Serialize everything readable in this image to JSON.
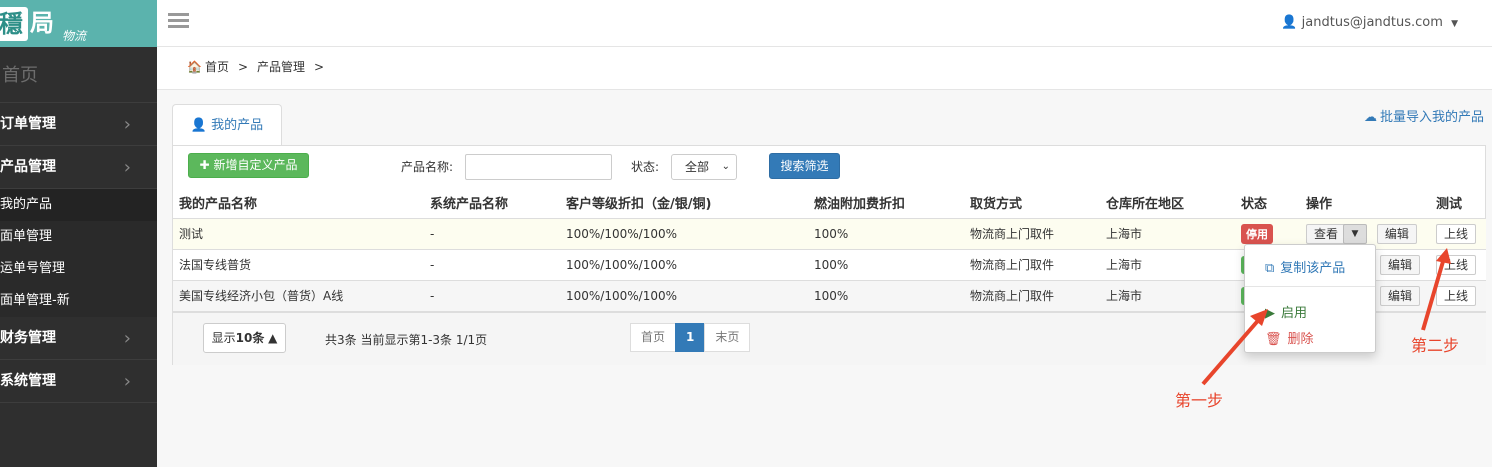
{
  "sidebar": {
    "logo_mark": "穩",
    "logo_mark2": "局",
    "logo_sub": "物流",
    "home": "首页",
    "items": [
      {
        "label": "订单管理"
      },
      {
        "label": "产品管理"
      },
      {
        "label": "财务管理"
      },
      {
        "label": "系统管理"
      }
    ],
    "sub_items": [
      {
        "label": "我的产品"
      },
      {
        "label": "面单管理"
      },
      {
        "label": "运单号管理"
      },
      {
        "label": "面单管理-新"
      }
    ]
  },
  "topbar": {
    "user": "jandtus@jandtus.com"
  },
  "breadcrumb": {
    "home": "首页",
    "sep1": ">",
    "current": "产品管理",
    "sep2": ">"
  },
  "tab": {
    "label": "我的产品"
  },
  "import_link": "批量导入我的产品",
  "filter": {
    "add_button": "新增自定义产品",
    "name_label": "产品名称:",
    "name_value": "",
    "status_label": "状态:",
    "status_selected": "全部",
    "search_button": "搜索筛选"
  },
  "table": {
    "headers": [
      "我的产品名称",
      "系统产品名称",
      "客户等级折扣（金/银/铜)",
      "燃油附加费折扣",
      "取货方式",
      "仓库所在地区",
      "状态",
      "操作",
      "测试"
    ],
    "rows": [
      {
        "name": "测试",
        "sys": "-",
        "discount": "100%/100%/100%",
        "fuel": "100%",
        "pickup": "物流商上门取件",
        "region": "上海市",
        "status": "停用"
      },
      {
        "name": "法国专线普货",
        "sys": "-",
        "discount": "100%/100%/100%",
        "fuel": "100%",
        "pickup": "物流商上门取件",
        "region": "上海市",
        "status": ""
      },
      {
        "name": "美国专线经济小包（普货）A线",
        "sys": "-",
        "discount": "100%/100%/100%",
        "fuel": "100%",
        "pickup": "物流商上门取件",
        "region": "上海市",
        "status": ""
      }
    ],
    "view_label": "查看",
    "edit_label": "编辑",
    "online_label": "上线"
  },
  "footer": {
    "per_page_prefix": "显示",
    "per_page_value": "10条",
    "info": "共3条 当前显示第1-3条 1/1页",
    "first": "首页",
    "current_page": "1",
    "last": "末页"
  },
  "dropdown": {
    "copy": "复制该产品",
    "enable": "启用",
    "delete": "删除"
  },
  "annotations": {
    "step1": "第一步",
    "step2": "第二步"
  },
  "colors": {
    "accent": "#337ab7",
    "success": "#5cb85c",
    "danger": "#d9534f",
    "logo_bg": "#5bb3ad",
    "annotation": "#e8452c"
  }
}
